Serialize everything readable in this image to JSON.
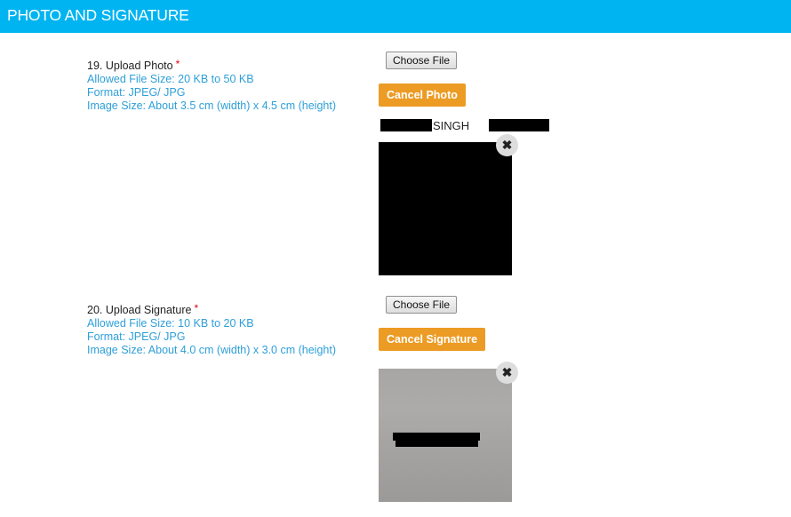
{
  "header": {
    "title": "PHOTO AND SIGNATURE",
    "background_color": "#00b4f1"
  },
  "photo_section": {
    "label": "19. Upload Photo",
    "required_mark": "*",
    "hints": [
      "Allowed File Size: 20 KB to 50 KB",
      "Format: JPEG/ JPG",
      "Image Size: About 3.5 cm (width) x 4.5 cm (height)"
    ],
    "choose_file_label": "Choose File",
    "cancel_label": "Cancel Photo",
    "name_visible_text": "SINGH",
    "remove_icon": "close-icon"
  },
  "signature_section": {
    "label": "20. Upload Signature",
    "required_mark": "*",
    "hints": [
      "Allowed File Size: 10 KB to 20 KB",
      "Format: JPEG/ JPG",
      "Image Size: About 4.0 cm (width) x 3.0 cm (height)"
    ],
    "choose_file_label": "Choose File",
    "cancel_label": "Cancel Signature",
    "remove_icon": "close-icon"
  },
  "colors": {
    "accent_button": "#ec9b24",
    "hint_text": "#2e9fd8",
    "required": "#e3000f"
  },
  "icons": {
    "close_glyph": "✖"
  }
}
